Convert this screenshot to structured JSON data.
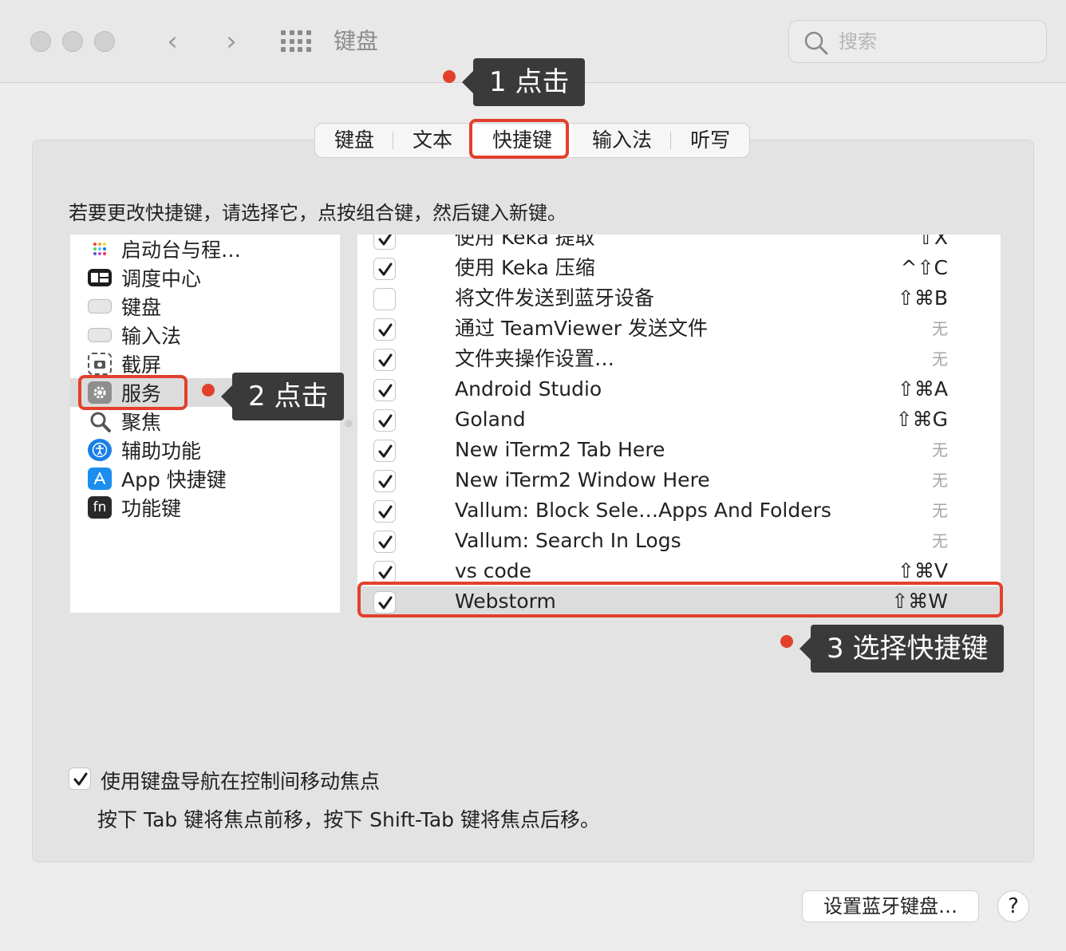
{
  "window": {
    "title": "键盘"
  },
  "search": {
    "placeholder": "搜索"
  },
  "tabs": [
    "键盘",
    "文本",
    "快捷键",
    "输入法",
    "听写"
  ],
  "instruction": "若要更改快捷键，请选择它，点按组合键，然后键入新键。",
  "left_items": [
    {
      "label": "启动台与程…",
      "icon": "launchpad-icon"
    },
    {
      "label": "调度中心",
      "icon": "mission-control-icon"
    },
    {
      "label": "键盘",
      "icon": "keyboard-icon"
    },
    {
      "label": "输入法",
      "icon": "keyboard-icon"
    },
    {
      "label": "截屏",
      "icon": "screenshot-icon"
    },
    {
      "label": "服务",
      "icon": "gear-icon",
      "selected": true
    },
    {
      "label": "聚焦",
      "icon": "spotlight-icon"
    },
    {
      "label": "辅助功能",
      "icon": "accessibility-icon"
    },
    {
      "label": "App 快捷键",
      "icon": "app-store-icon"
    },
    {
      "label": "功能键",
      "icon": "fn-key-icon"
    }
  ],
  "shortcuts": [
    {
      "label": "使用 Keka 提取",
      "key": "⇧X",
      "checked": true
    },
    {
      "label": "使用 Keka 压缩",
      "key": "^⇧C",
      "checked": true
    },
    {
      "label": "将文件发送到蓝牙设备",
      "key": "⇧⌘B",
      "checked": false
    },
    {
      "label": "通过 TeamViewer 发送文件",
      "key": "无",
      "checked": true
    },
    {
      "label": "文件夹操作设置…",
      "key": "无",
      "checked": true
    },
    {
      "label": "Android Studio",
      "key": "⇧⌘A",
      "checked": true
    },
    {
      "label": "Goland",
      "key": "⇧⌘G",
      "checked": true
    },
    {
      "label": "New iTerm2 Tab Here",
      "key": "无",
      "checked": true
    },
    {
      "label": "New iTerm2 Window Here",
      "key": "无",
      "checked": true
    },
    {
      "label": "Vallum: Block Sele…Apps And Folders",
      "key": "无",
      "checked": true
    },
    {
      "label": "Vallum: Search In Logs",
      "key": "无",
      "checked": true
    },
    {
      "label": "vs code",
      "key": "⇧⌘V",
      "checked": true
    },
    {
      "label": "Webstorm",
      "key": "⇧⌘W",
      "checked": true,
      "selected": true
    }
  ],
  "callouts": {
    "c1": "1 点击",
    "c2": "2 点击",
    "c3": "3 选择快捷键"
  },
  "keyboard_nav": {
    "label": "使用键盘导航在控制间移动焦点",
    "sub": "按下 Tab 键将焦点前移，按下 Shift-Tab 键将焦点后移。",
    "checked": true
  },
  "buttons": {
    "setup_bluetooth": "设置蓝牙键盘…",
    "help": "?"
  },
  "colors": {
    "highlight": "#e2402b",
    "callout_bg": "#3a3a3a"
  }
}
